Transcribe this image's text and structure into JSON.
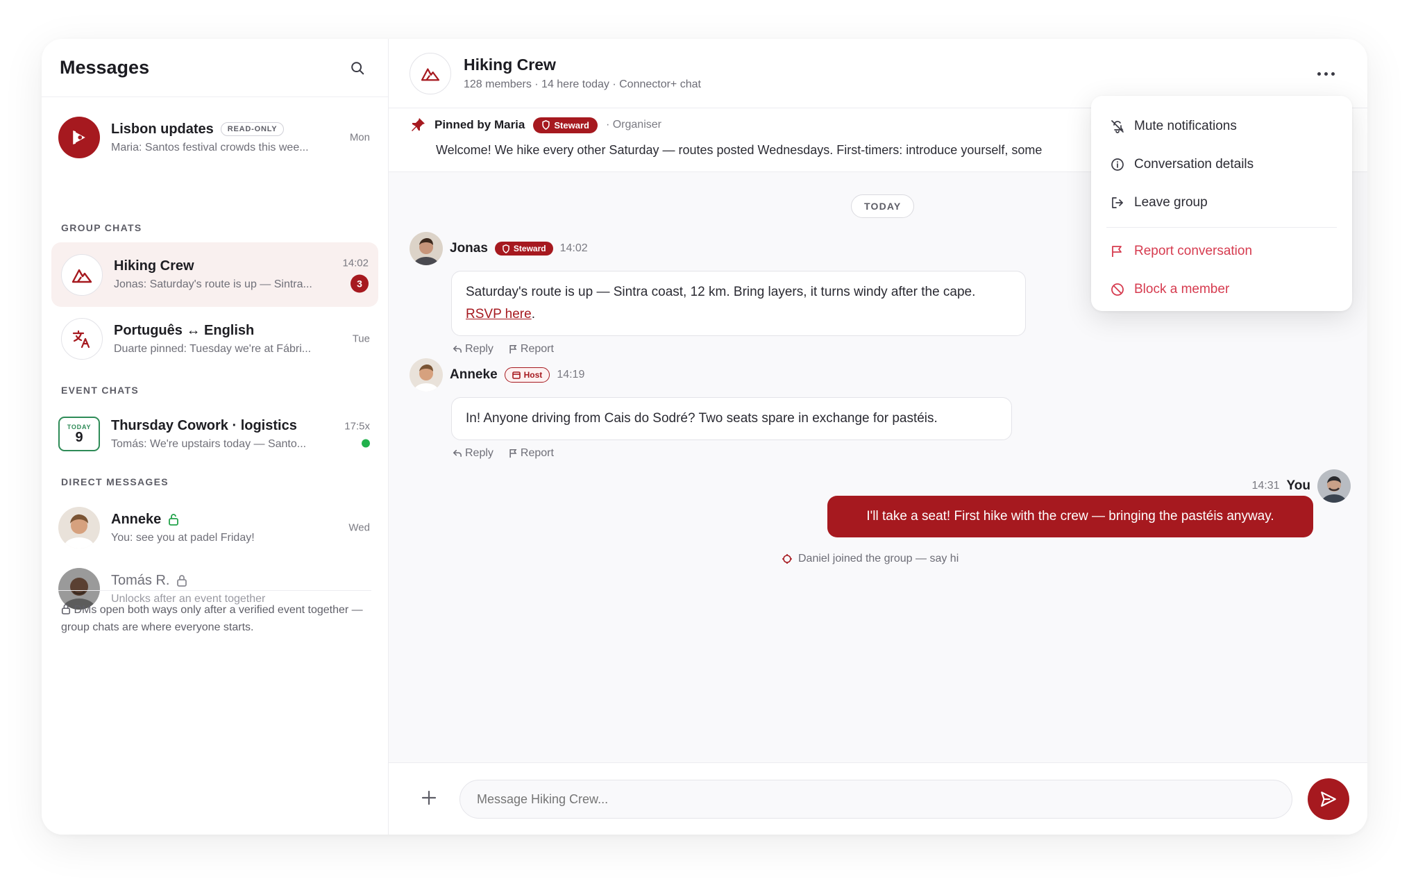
{
  "sidebar": {
    "title": "Messages",
    "announcement": {
      "name": "Lisbon updates",
      "badge": "READ-ONLY",
      "preview": "Maria: Santos festival crowds this wee...",
      "time": "Mon"
    },
    "sections": {
      "group": "GROUP CHATS",
      "event": "EVENT CHATS",
      "direct": "DIRECT MESSAGES"
    },
    "group_chats": [
      {
        "name": "Hiking Crew",
        "preview": "Jonas: Saturday's route is up — Sintra...",
        "time": "14:02",
        "unread": "3"
      },
      {
        "name": "Português ↔ English",
        "preview": "Duarte pinned: Tuesday we're at Fábri...",
        "time": "Tue"
      }
    ],
    "event_chat": {
      "day_label": "TODAY",
      "day": "9",
      "name": "Thursday Cowork · logistics",
      "preview": "Tomás: We're upstairs today — Santo...",
      "time": "17:5x"
    },
    "direct": [
      {
        "name": "Anneke",
        "preview": "You: see you at padel Friday!",
        "time": "Wed"
      },
      {
        "name": "Tomás R.",
        "preview": "Unlocks after an event together",
        "time": ""
      }
    ],
    "note": "DMs open both ways only after a verified event together — group chats are where everyone starts."
  },
  "chat": {
    "title": "Hiking Crew",
    "subtitle": "128 members · 14 here today · Connector+ chat",
    "pinned": {
      "by": "Pinned by Maria",
      "badge": "Steward",
      "role": "· Organiser",
      "text": "Welcome! We hike every other Saturday — routes posted Wednesdays. First-timers: introduce yourself, some"
    },
    "today": "TODAY",
    "messages": [
      {
        "name": "Jonas",
        "badge": "Steward",
        "time": "14:02",
        "text": "Saturday's route is up — Sintra coast, 12 km. Bring layers, it turns windy after the cape.",
        "link": "RSVP here",
        "after_link": "."
      },
      {
        "name": "Anneke",
        "badge": "Host",
        "time": "14:19",
        "text": "In! Anyone driving from Cais do Sodré? Two seats spare in exchange for pastéis."
      }
    ],
    "actions": {
      "reply": "Reply",
      "report": "Report"
    },
    "mine": {
      "time": "14:31",
      "name": "You",
      "text": "I'll take a seat! First hike with the crew — bringing the pastéis anyway."
    },
    "system": "Daniel joined the group — say hi",
    "composer": {
      "placeholder": "Message Hiking Crew..."
    }
  },
  "menu": {
    "mute": "Mute notifications",
    "details": "Conversation details",
    "leave": "Leave group",
    "report": "Report conversation",
    "block": "Block a member"
  },
  "colors": {
    "brand": "#a6191f",
    "danger": "#d63b4f",
    "online": "#22b14c",
    "event": "#2e8b57"
  }
}
